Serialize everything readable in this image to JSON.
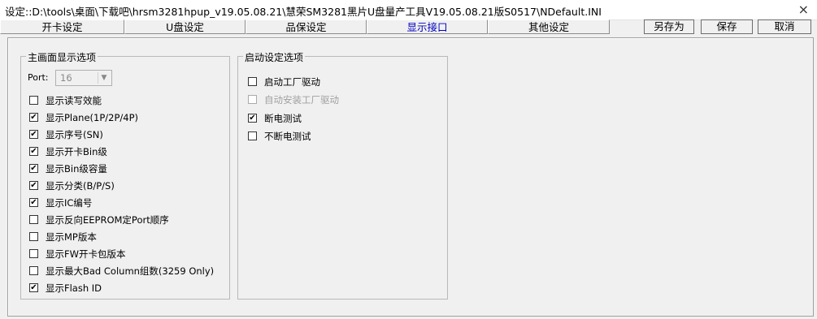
{
  "window": {
    "title": "设定::D:\\tools\\桌面\\下载吧\\hrsm3281hpup_v19.05.08.21\\慧荣SM3281黑片U盘量产工具V19.05.08.21版S0517\\NDefault.INI",
    "close": "×"
  },
  "tabs": [
    {
      "label": "开卡设定"
    },
    {
      "label": "U盘设定"
    },
    {
      "label": "品保设定"
    },
    {
      "label": "显示接口",
      "active": true
    },
    {
      "label": "其他设定"
    }
  ],
  "buttons": {
    "save_as": "另存为",
    "save": "保存",
    "cancel": "取消"
  },
  "main_group": {
    "title": "主画面显示选项",
    "port_label": "Port:",
    "port_value": "16",
    "items": [
      {
        "label": "显示读写效能",
        "checked": false
      },
      {
        "label": "显示Plane(1P/2P/4P)",
        "checked": true
      },
      {
        "label": "显示序号(SN)",
        "checked": true
      },
      {
        "label": "显示开卡Bin级",
        "checked": true
      },
      {
        "label": "显示Bin级容量",
        "checked": true
      },
      {
        "label": "显示分类(B/P/S)",
        "checked": true
      },
      {
        "label": "显示IC编号",
        "checked": true
      },
      {
        "label": "显示反向EEPROM定Port顺序",
        "checked": false
      },
      {
        "label": "显示MP版本",
        "checked": false
      },
      {
        "label": "显示FW开卡包版本",
        "checked": false
      },
      {
        "label": "显示最大Bad Column组数(3259 Only)",
        "checked": false
      },
      {
        "label": "显示Flash ID",
        "checked": true
      }
    ]
  },
  "startup_group": {
    "title": "启动设定选项",
    "items": [
      {
        "label": "启动工厂驱动",
        "checked": false,
        "disabled": false
      },
      {
        "label": "自动安装工厂驱动",
        "checked": false,
        "disabled": true
      },
      {
        "label": "断电测试",
        "checked": true,
        "disabled": false
      },
      {
        "label": "不断电测试",
        "checked": false,
        "disabled": false
      }
    ]
  },
  "check_mark": "✔",
  "dropdown_arrow": "▼"
}
